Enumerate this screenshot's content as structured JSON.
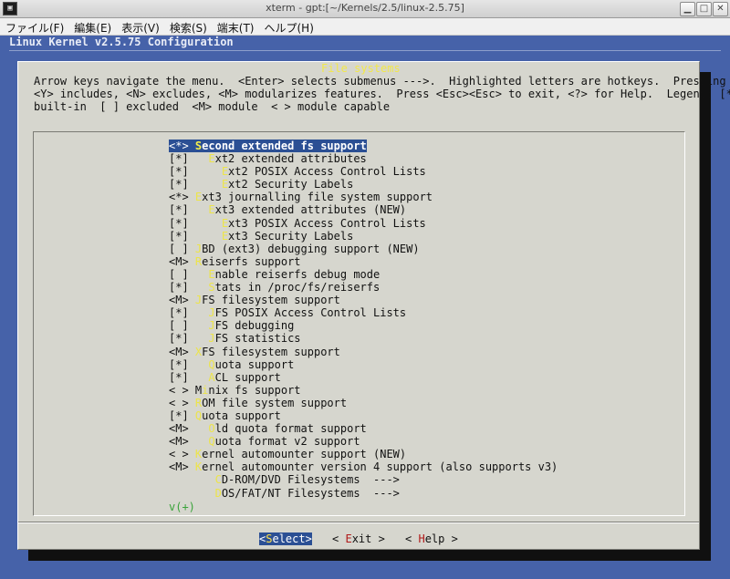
{
  "window": {
    "title": "xterm - gpt:[~/Kernels/2.5/linux-2.5.75]",
    "icon": "terminal-icon",
    "buttons": [
      "minimize",
      "maximize",
      "close"
    ]
  },
  "menubar": [
    "ファイル(F)",
    "編集(E)",
    "表示(V)",
    "検索(S)",
    "端末(T)",
    "ヘルプ(H)"
  ],
  "terminal": {
    "header": "Linux Kernel v2.5.75 Configuration"
  },
  "dialog": {
    "title": "File systems",
    "help_lines": [
      "Arrow keys navigate the menu.  <Enter> selects submenus --->.  Highlighted letters are hotkeys.  Pressing",
      "<Y> includes, <N> excludes, <M> modularizes features.  Press <Esc><Esc> to exit, <?> for Help.  Legend: [*]",
      "built-in  [ ] excluded  <M> module  < > module capable"
    ],
    "items": [
      {
        "mark": "<*>",
        "pre": " ",
        "hot": "S",
        "rest": "econd extended fs support",
        "selected": true
      },
      {
        "mark": "[*]",
        "pre": "   ",
        "hot": "E",
        "rest": "xt2 extended attributes"
      },
      {
        "mark": "[*]",
        "pre": "     ",
        "hot": "E",
        "rest": "xt2 POSIX Access Control Lists"
      },
      {
        "mark": "[*]",
        "pre": "     ",
        "hot": "E",
        "rest": "xt2 Security Labels"
      },
      {
        "mark": "<*>",
        "pre": " ",
        "hot": "E",
        "rest": "xt3 journalling file system support"
      },
      {
        "mark": "[*]",
        "pre": "   ",
        "hot": "E",
        "rest": "xt3 extended attributes (NEW)"
      },
      {
        "mark": "[*]",
        "pre": "     ",
        "hot": "E",
        "rest": "xt3 POSIX Access Control Lists"
      },
      {
        "mark": "[*]",
        "pre": "     ",
        "hot": "E",
        "rest": "xt3 Security Labels"
      },
      {
        "mark": "[ ]",
        "pre": " ",
        "hot": "J",
        "rest": "BD (ext3) debugging support (NEW)"
      },
      {
        "mark": "<M>",
        "pre": " ",
        "hot": "R",
        "rest": "eiserfs support"
      },
      {
        "mark": "[ ]",
        "pre": "   ",
        "hot": "E",
        "rest": "nable reiserfs debug mode"
      },
      {
        "mark": "[*]",
        "pre": "   ",
        "hot": "S",
        "rest": "tats in /proc/fs/reiserfs"
      },
      {
        "mark": "<M>",
        "pre": " ",
        "hot": "J",
        "rest": "FS filesystem support"
      },
      {
        "mark": "[*]",
        "pre": "   ",
        "hot": "J",
        "rest": "FS POSIX Access Control Lists"
      },
      {
        "mark": "[ ]",
        "pre": "   ",
        "hot": "J",
        "rest": "FS debugging"
      },
      {
        "mark": "[*]",
        "pre": "   ",
        "hot": "J",
        "rest": "FS statistics"
      },
      {
        "mark": "<M>",
        "pre": " ",
        "hot": "X",
        "rest": "FS filesystem support"
      },
      {
        "mark": "[*]",
        "pre": "   ",
        "hot": "Q",
        "rest": "uota support"
      },
      {
        "mark": "[*]",
        "pre": "   ",
        "hot": "A",
        "rest": "CL support"
      },
      {
        "mark": "< >",
        "pre": " M",
        "hot": "i",
        "rest": "nix fs support"
      },
      {
        "mark": "< >",
        "pre": " ",
        "hot": "R",
        "rest": "OM file system support"
      },
      {
        "mark": "[*]",
        "pre": " ",
        "hot": "Q",
        "rest": "uota support"
      },
      {
        "mark": "<M>",
        "pre": "   ",
        "hot": "O",
        "rest": "ld quota format support"
      },
      {
        "mark": "<M>",
        "pre": "   ",
        "hot": "Q",
        "rest": "uota format v2 support"
      },
      {
        "mark": "< >",
        "pre": " ",
        "hot": "K",
        "rest": "ernel automounter support (NEW)"
      },
      {
        "mark": "<M>",
        "pre": " ",
        "hot": "K",
        "rest": "ernel automounter version 4 support (also supports v3)"
      },
      {
        "mark": "   ",
        "pre": "    ",
        "hot": "C",
        "rest": "D-ROM/DVD Filesystems  --->"
      },
      {
        "mark": "   ",
        "pre": "    ",
        "hot": "D",
        "rest": "OS/FAT/NT Filesystems  --->"
      }
    ],
    "more_indicator": "v(+)",
    "buttons": [
      {
        "pre": "<",
        "hot": "S",
        "rest": "elect>",
        "selected": true
      },
      {
        "pre": "< ",
        "hot": "E",
        "rest": "xit >",
        "selected": false
      },
      {
        "pre": "< ",
        "hot": "H",
        "rest": "elp >",
        "selected": false
      }
    ]
  }
}
